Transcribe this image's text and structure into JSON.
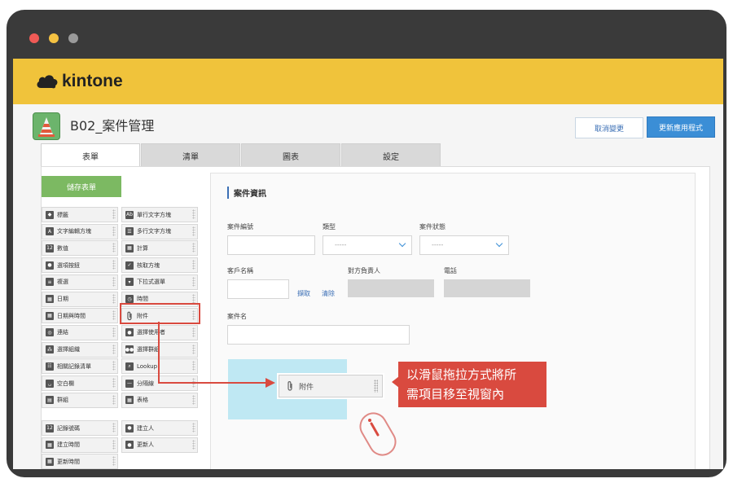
{
  "window": {
    "dots": [
      "#f05a56",
      "#f5c242",
      "#9a9a9a"
    ]
  },
  "brand": {
    "name": "kintone",
    "color": "#f0c33b"
  },
  "app": {
    "title": "B02_案件管理",
    "cancel_label": "取消變更",
    "update_label": "更新應用程式"
  },
  "tabs": [
    {
      "label": "表單",
      "active": true
    },
    {
      "label": "清單",
      "active": false
    },
    {
      "label": "圖表",
      "active": false
    },
    {
      "label": "設定",
      "active": false
    }
  ],
  "save_label": "儲存表單",
  "palette": {
    "left": [
      {
        "label": "標籤",
        "icon": "tag-icon"
      },
      {
        "label": "文字編輯方塊",
        "icon": "text-area-icon"
      },
      {
        "label": "數值",
        "icon": "number-icon"
      },
      {
        "label": "選項按鈕",
        "icon": "radio-icon"
      },
      {
        "label": "複選",
        "icon": "multi-select-icon"
      },
      {
        "label": "日期",
        "icon": "date-icon"
      },
      {
        "label": "日期與時間",
        "icon": "datetime-icon"
      },
      {
        "label": "連結",
        "icon": "link-icon"
      },
      {
        "label": "選擇組織",
        "icon": "org-icon"
      },
      {
        "label": "相關記錄清單",
        "icon": "related-records-icon"
      },
      {
        "label": "空白欄",
        "icon": "blank-space-icon"
      },
      {
        "label": "群組",
        "icon": "group-icon"
      }
    ],
    "right": [
      {
        "label": "單行文字方塊",
        "icon": "single-line-icon"
      },
      {
        "label": "多行文字方塊",
        "icon": "multi-line-icon"
      },
      {
        "label": "計算",
        "icon": "calc-icon"
      },
      {
        "label": "核取方塊",
        "icon": "checkbox-icon"
      },
      {
        "label": "下拉式選單",
        "icon": "dropdown-icon"
      },
      {
        "label": "時間",
        "icon": "clock-icon"
      },
      {
        "label": "附件",
        "icon": "paperclip-icon"
      },
      {
        "label": "選擇使用者",
        "icon": "user-icon"
      },
      {
        "label": "選擇群組",
        "icon": "user-group-icon"
      },
      {
        "label": "Lookup",
        "icon": "lookup-icon"
      },
      {
        "label": "分隔線",
        "icon": "divider-icon"
      },
      {
        "label": "表格",
        "icon": "table-icon"
      }
    ],
    "system_left": [
      {
        "label": "記錄號碼",
        "icon": "record-number-icon"
      },
      {
        "label": "建立時間",
        "icon": "created-time-icon"
      },
      {
        "label": "更新時間",
        "icon": "updated-time-icon"
      }
    ],
    "system_right": [
      {
        "label": "建立人",
        "icon": "creator-icon"
      },
      {
        "label": "更新人",
        "icon": "updater-icon"
      }
    ]
  },
  "form": {
    "section_title": "案件資訊",
    "labels": {
      "case_no": "案件編號",
      "type": "類型",
      "status": "案件狀態",
      "customer": "客戶名稱",
      "contact": "對方負責人",
      "phone": "電話",
      "case_name": "案件名"
    },
    "select_placeholder": "-----",
    "lookup_get": "擷取",
    "lookup_clear": "清除"
  },
  "drag": {
    "label": "附件",
    "icon": "paperclip-icon"
  },
  "callout": {
    "line1": "以滑鼠拖拉方式將所",
    "line2": "需項目移至視窗內",
    "color": "#d94a3f"
  }
}
